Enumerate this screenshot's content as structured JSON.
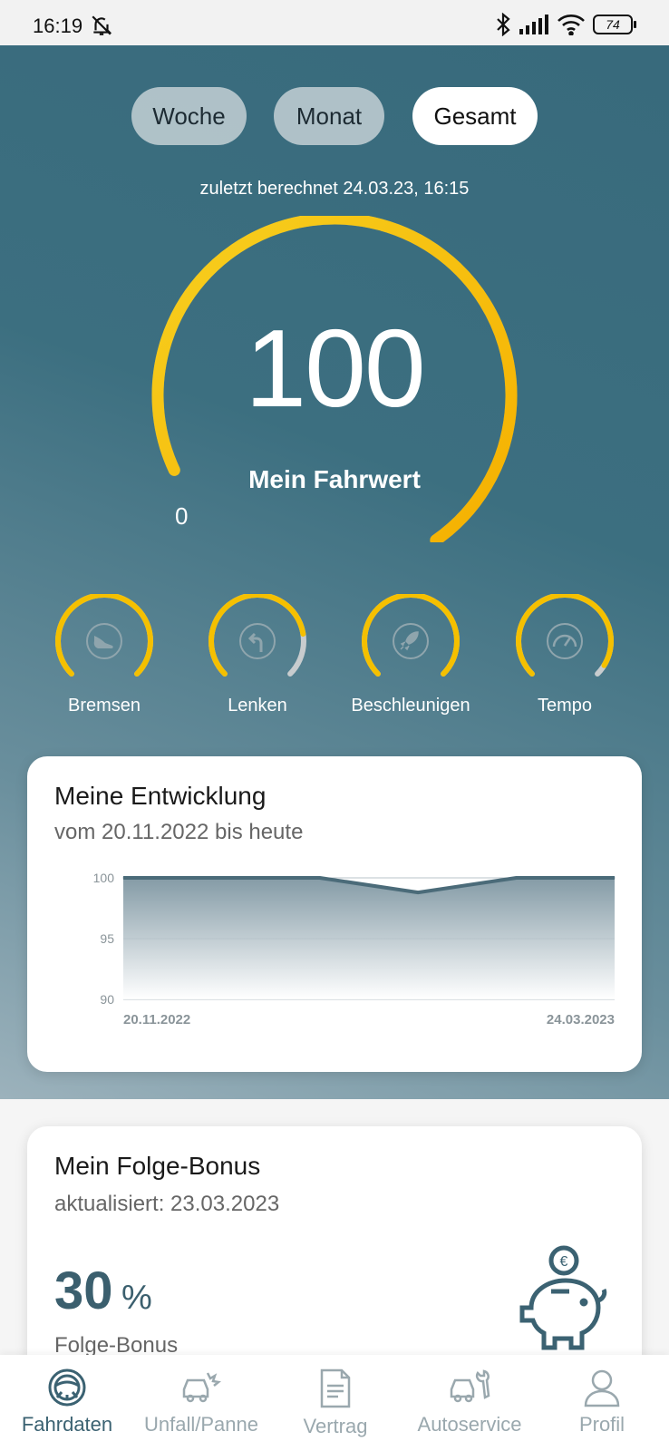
{
  "status_bar": {
    "time": "16:19",
    "battery": "74"
  },
  "periods": [
    {
      "label": "Woche",
      "active": false
    },
    {
      "label": "Monat",
      "active": false
    },
    {
      "label": "Gesamt",
      "active": true
    }
  ],
  "last_calculated": "zuletzt berechnet 24.03.23, 16:15",
  "score": {
    "value": "100",
    "label": "Mein Fahrwert",
    "min_label": "0",
    "fraction": 1.0
  },
  "categories": [
    {
      "label": "Bremsen",
      "icon": "shoe-icon",
      "fraction": 1.0
    },
    {
      "label": "Lenken",
      "icon": "turn-left-icon",
      "fraction": 0.8
    },
    {
      "label": "Beschleunigen",
      "icon": "rocket-icon",
      "fraction": 1.0
    },
    {
      "label": "Tempo",
      "icon": "speedometer-icon",
      "fraction": 0.95
    }
  ],
  "development": {
    "title": "Meine Entwicklung",
    "subtitle": "vom 20.11.2022 bis heute"
  },
  "chart_data": {
    "type": "area",
    "x": [
      "20.11.2022",
      "",
      "",
      "",
      "",
      "24.03.2023"
    ],
    "series": [
      {
        "values": [
          100,
          100,
          100,
          98.8,
          100,
          100
        ]
      }
    ],
    "x_tick_labels": [
      "20.11.2022",
      "24.03.2023"
    ],
    "y_ticks": [
      "100",
      "95",
      "90"
    ],
    "ylim": [
      90,
      100
    ],
    "grid": true
  },
  "bonus": {
    "title": "Mein Folge-Bonus",
    "updated": "aktualisiert: 23.03.2023",
    "value": "30",
    "unit": "%",
    "label": "Folge-Bonus"
  },
  "nav": [
    {
      "label": "Fahrdaten",
      "icon": "steering-wheel-icon",
      "active": true
    },
    {
      "label": "Unfall/Panne",
      "icon": "car-crash-icon",
      "active": false
    },
    {
      "label": "Vertrag",
      "icon": "document-icon",
      "active": false
    },
    {
      "label": "Autoservice",
      "icon": "car-wrench-icon",
      "active": false
    },
    {
      "label": "Profil",
      "icon": "person-icon",
      "active": false
    }
  ],
  "colors": {
    "accent": "#f5b800",
    "primary": "#3b6272",
    "hero_bg": "#3c6f80"
  }
}
